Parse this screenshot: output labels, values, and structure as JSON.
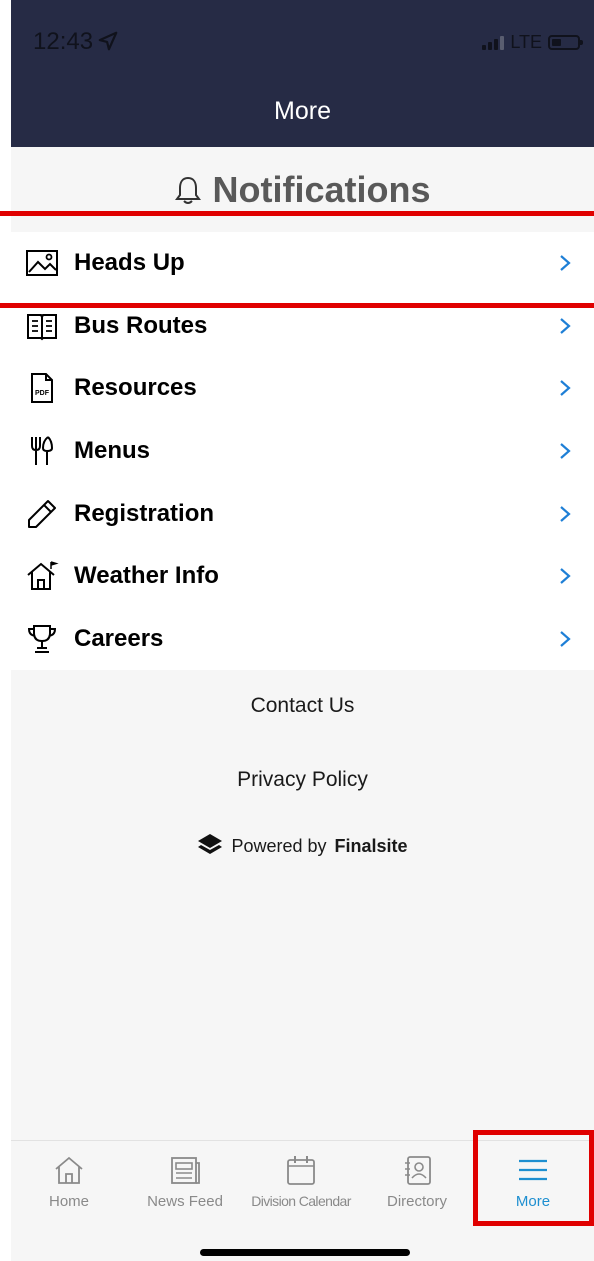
{
  "status_bar": {
    "time": "12:43",
    "network": "LTE"
  },
  "header": {
    "title": "More"
  },
  "notifications": {
    "title": "Notifications"
  },
  "menu": {
    "items": [
      {
        "label": "Heads Up",
        "icon": "image-icon"
      },
      {
        "label": "Bus Routes",
        "icon": "book-icon"
      },
      {
        "label": "Resources",
        "icon": "pdf-icon"
      },
      {
        "label": "Menus",
        "icon": "utensils-icon"
      },
      {
        "label": "Registration",
        "icon": "pencil-icon"
      },
      {
        "label": "Weather Info",
        "icon": "house-flag-icon"
      },
      {
        "label": "Careers",
        "icon": "trophy-icon"
      }
    ]
  },
  "footer": {
    "contact": "Contact Us",
    "privacy": "Privacy Policy",
    "powered_prefix": "Powered by",
    "powered_brand": "Finalsite"
  },
  "tabbar": {
    "tabs": [
      {
        "label": "Home",
        "icon": "home-icon",
        "active": false
      },
      {
        "label": "News Feed",
        "icon": "newspaper-icon",
        "active": false
      },
      {
        "label": "Division Calendar",
        "icon": "calendar-icon",
        "active": false
      },
      {
        "label": "Directory",
        "icon": "contacts-icon",
        "active": false
      },
      {
        "label": "More",
        "icon": "menu-icon",
        "active": true
      }
    ]
  },
  "colors": {
    "header_bg": "#262b45",
    "accent": "#1e8fd0",
    "highlight": "#e00000",
    "chevron": "#1e7fd6"
  }
}
